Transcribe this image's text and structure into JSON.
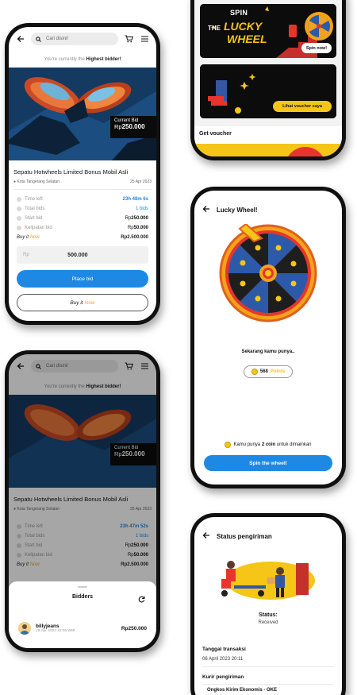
{
  "colors": {
    "primary": "#1e88e5",
    "accent_yellow": "#f5c518",
    "accent_orange": "#f5a623",
    "dark": "#0b0b0b"
  },
  "auction": {
    "search_placeholder": "Cari disini!",
    "banner_prefix": "You're currently the ",
    "banner_bold": "Highest bidder!",
    "current_bid_label": "Current Bid",
    "currency": "Rp",
    "current_bid_value": "250.000",
    "title": "Sepatu Hotwheels Limited Bonus Mobil Asli",
    "location": "Kota Tangerang Selatan",
    "date": "25 Apr 2023",
    "stats": [
      {
        "label": "Time left",
        "value": "23h 48m 6s"
      },
      {
        "label": "Total bids",
        "value": "1 bids"
      },
      {
        "label": "Start bid",
        "prefix": "Rp",
        "value": "250.000"
      },
      {
        "label": "Kelipatan bid",
        "prefix": "Rp",
        "value": "50.000"
      }
    ],
    "buy_it_label": "Buy it",
    "now_label": "Now",
    "buy_it_price": "Rp2.500.000",
    "amount_prefix": "Rp",
    "amount_value": "500.000",
    "place_bid_label": "Place bid",
    "buy_it_now_button": "Buy it",
    "buy_it_now_button_now": "Now"
  },
  "auction2": {
    "time_left": "23h 47m 52s",
    "sheet_title": "Bidders",
    "bidder": {
      "name": "billyjeans",
      "timestamp": "29 Apr 2023 22:05 WIB",
      "amount": "Rp250.000"
    }
  },
  "home": {
    "banner1": {
      "spin": "SPIN",
      "the": "THE",
      "lucky": "LUCKY",
      "wheel": "WHEEL",
      "button": "Spin now!"
    },
    "banner2": {
      "button": "Lihat voucher saya"
    },
    "section_title": "Get voucher"
  },
  "lucky_wheel": {
    "title": "Lucky Wheel!",
    "caption": "Sekarang kamu punya..",
    "points_value": "568",
    "points_label": "Points",
    "coin_prefix": "Kamu punya ",
    "coin_bold": "2 coin",
    "coin_suffix": " untuk dimainkan",
    "spin_button": "Spin the wheel!"
  },
  "shipping": {
    "title": "Status pengiriman",
    "status_label": "Status:",
    "status_value": "Received",
    "transaction_label": "Tanggal transaksi",
    "transaction_value": "06 April 2023 20:11",
    "courier_label": "Kurir pengiriman",
    "courier_value": "Ongkos Kirim Ekonomis - OKE"
  }
}
